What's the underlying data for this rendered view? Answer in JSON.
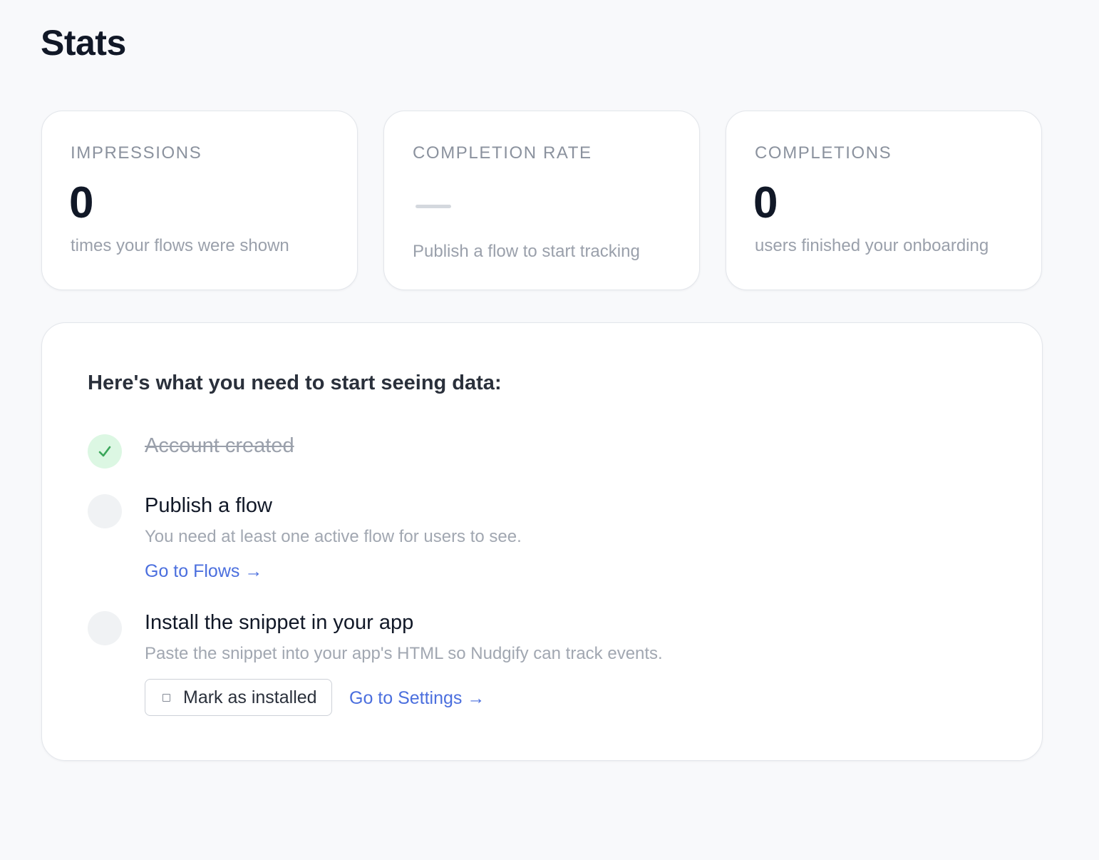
{
  "page": {
    "title": "Stats"
  },
  "stats": [
    {
      "label": "IMPRESSIONS",
      "value": "0",
      "subtitle": "times your flows were shown"
    },
    {
      "label": "COMPLETION RATE",
      "value": "—",
      "subtitle": "Publish a flow to start tracking"
    },
    {
      "label": "COMPLETIONS",
      "value": "0",
      "subtitle": "users finished your onboarding"
    }
  ],
  "checklist": {
    "heading": "Here's what you need to start seeing data:",
    "steps": [
      {
        "title": "Account created",
        "completed": true
      },
      {
        "title": "Publish a flow",
        "description": "You need at least one active flow for users to see.",
        "link_label": "Go to Flows →",
        "completed": false
      },
      {
        "title": "Install the snippet in your app",
        "description": "Paste the snippet into your app's HTML so Nudgify can track events.",
        "button_label": "Mark as installed",
        "checkbox_checked": false,
        "link_label": "Go to Settings →",
        "completed": false
      }
    ]
  },
  "colors": {
    "background": "#f8f9fb",
    "accent_link": "#4b6fde",
    "success_bg": "#dcf7e3",
    "success_check": "#3aa65a"
  }
}
